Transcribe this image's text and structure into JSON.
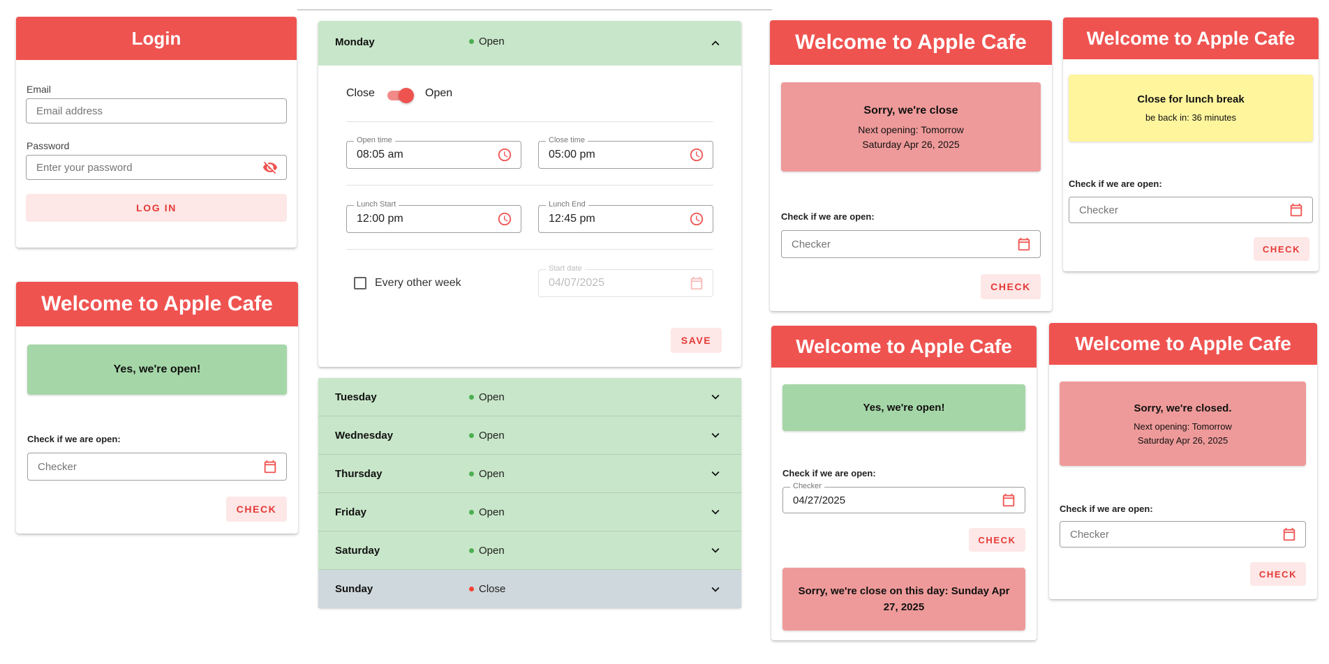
{
  "colors": {
    "primary": "#ef5350",
    "open_green": "#a5d6a7",
    "closed_red": "#ef9a9a",
    "lunch_yellow": "#fff59d",
    "open_row": "#c8e6c9",
    "closed_row": "#cfd8dc"
  },
  "login": {
    "title": "Login",
    "email_label": "Email",
    "email_placeholder": "Email address",
    "password_label": "Password",
    "password_placeholder": "Enter your password",
    "login_button": "LOG IN"
  },
  "cafe_common": {
    "title": "Welcome to Apple Cafe",
    "check_label": "Check if we are open:",
    "checker_placeholder": "Checker",
    "checker_label": "Checker",
    "check_button": "CHECK"
  },
  "cafe_open": {
    "status": "Yes, we're open!"
  },
  "cafe_close": {
    "status_title": "Sorry, we're close",
    "line1": "Next opening: Tomorrow",
    "line2": "Saturday Apr 26, 2025"
  },
  "cafe_lunch": {
    "status_title": "Close for lunch break",
    "line1": "be back in: 36 minutes"
  },
  "cafe_checked": {
    "status": "Yes, we're open!",
    "checker_value": "04/27/2025",
    "result": "Sorry, we're close on this day: Sunday Apr 27, 2025"
  },
  "cafe_closed": {
    "status_title": "Sorry, we're closed.",
    "line1": "Next opening: Tomorrow",
    "line2": "Saturday Apr 26, 2025"
  },
  "schedule": {
    "expanded": {
      "day": "Monday",
      "status": "Open",
      "toggle_off_label": "Close",
      "toggle_on_label": "Open",
      "toggle_on": true,
      "open_time_label": "Open time",
      "open_time": "08:05 am",
      "close_time_label": "Close time",
      "close_time": "05:00 pm",
      "lunch_start_label": "Lunch Start",
      "lunch_start": "12:00 pm",
      "lunch_end_label": "Lunch End",
      "lunch_end": "12:45 pm",
      "every_other_week": "Every other week",
      "start_date_label": "Start date",
      "start_date": "04/07/2025",
      "save_button": "SAVE"
    },
    "days": [
      {
        "day": "Tuesday",
        "status": "Open"
      },
      {
        "day": "Wednesday",
        "status": "Open"
      },
      {
        "day": "Thursday",
        "status": "Open"
      },
      {
        "day": "Friday",
        "status": "Open"
      },
      {
        "day": "Saturday",
        "status": "Open"
      },
      {
        "day": "Sunday",
        "status": "Close"
      }
    ]
  }
}
